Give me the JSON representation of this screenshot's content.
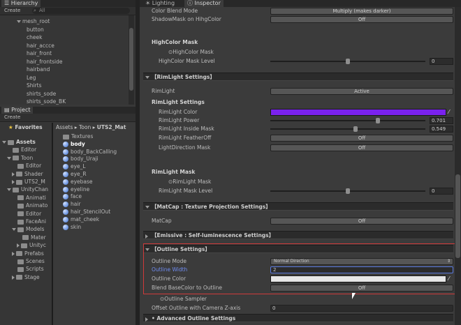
{
  "hierarchy": {
    "tab": "Hierarchy",
    "create": "Create",
    "search": "All",
    "items": [
      {
        "label": "mesh_root",
        "indent": 1,
        "arrow": "down"
      },
      {
        "label": "button",
        "indent": 2
      },
      {
        "label": "cheek",
        "indent": 2
      },
      {
        "label": "hair_accce",
        "indent": 2
      },
      {
        "label": "hair_front",
        "indent": 2
      },
      {
        "label": "hair_frontside",
        "indent": 2
      },
      {
        "label": "hairband",
        "indent": 2
      },
      {
        "label": "Leg",
        "indent": 2
      },
      {
        "label": "Shirts",
        "indent": 2
      },
      {
        "label": "shirts_sode",
        "indent": 2
      },
      {
        "label": "shirts_sode_BK",
        "indent": 2
      }
    ]
  },
  "project": {
    "tab": "Project",
    "create": "Create",
    "favorites": "Favorites",
    "folders": [
      {
        "label": "Assets",
        "indent": 0,
        "arrow": "down",
        "bold": true
      },
      {
        "label": "Editor",
        "indent": 1
      },
      {
        "label": "Toon",
        "indent": 1,
        "arrow": "down"
      },
      {
        "label": "Editor",
        "indent": 2
      },
      {
        "label": "Shader",
        "indent": 2,
        "arrow": "right"
      },
      {
        "label": "UTS2_M",
        "indent": 2,
        "arrow": "right"
      },
      {
        "label": "UnityChan",
        "indent": 1,
        "arrow": "down"
      },
      {
        "label": "Animati",
        "indent": 2
      },
      {
        "label": "Animato",
        "indent": 2
      },
      {
        "label": "Editor",
        "indent": 2
      },
      {
        "label": "FaceAni",
        "indent": 2
      },
      {
        "label": "Models",
        "indent": 2,
        "arrow": "down"
      },
      {
        "label": "Mater",
        "indent": 3
      },
      {
        "label": "Unityc",
        "indent": 3,
        "arrow": "right"
      },
      {
        "label": "Prefabs",
        "indent": 2,
        "arrow": "right"
      },
      {
        "label": "Scenes",
        "indent": 2
      },
      {
        "label": "Scripts",
        "indent": 2
      },
      {
        "label": "Stage",
        "indent": 2,
        "arrow": "right"
      }
    ],
    "breadcrumb": [
      "Assets",
      "Toon",
      "UTS2_Mat"
    ],
    "assets": [
      {
        "label": "Textures",
        "kind": "folder"
      },
      {
        "label": "body",
        "kind": "material",
        "selected": true
      },
      {
        "label": "body_BackCalling",
        "kind": "material"
      },
      {
        "label": "body_Uraji",
        "kind": "material"
      },
      {
        "label": "eye_L",
        "kind": "material"
      },
      {
        "label": "eye_R",
        "kind": "material"
      },
      {
        "label": "eyebase",
        "kind": "material"
      },
      {
        "label": "eyeline",
        "kind": "material"
      },
      {
        "label": "face",
        "kind": "material"
      },
      {
        "label": "hair",
        "kind": "material"
      },
      {
        "label": "hair_StencilOut",
        "kind": "material"
      },
      {
        "label": "mat_cheek",
        "kind": "material"
      },
      {
        "label": "skin",
        "kind": "material"
      }
    ]
  },
  "inspector": {
    "tabs": [
      "Lighting",
      "Inspector"
    ],
    "color_blend_mode": {
      "label": "Color Blend Mode",
      "value": "Multiply (makes darker)"
    },
    "shadowmask": {
      "label": "ShadowMask on HihgColor",
      "value": "Off"
    },
    "highcolor_mask_header": "HighColor Mask",
    "highcolor_mask": "HighColor Mask",
    "highcolor_mask_level": {
      "label": "HighColor Mask Level",
      "value": "0",
      "fraction": 0.5
    },
    "rimlight_section": "【RimLight Settings】",
    "rimlight": {
      "label": "RimLight",
      "value": "Active"
    },
    "rimlight_settings_header": "RimLight Settings",
    "rimlight_color": {
      "label": "RimLight Color",
      "color": "#7a22ee"
    },
    "rimlight_power": {
      "label": "RimLight Power",
      "value": "0.701",
      "fraction": 0.7
    },
    "rimlight_inside_mask": {
      "label": "RimLight Inside Mask",
      "value": "0.549",
      "fraction": 0.55
    },
    "rimlight_featheroff": {
      "label": "RimLight FeatherOff",
      "value": "Off"
    },
    "lightdirection_mask": {
      "label": "LightDirection Mask",
      "value": "Off"
    },
    "rimlight_mask_header": "RimLight Mask",
    "rimlight_mask": "RimLight Mask",
    "rimlight_mask_level": {
      "label": "RimLight Mask Level",
      "value": "0",
      "fraction": 0.5
    },
    "matcap_section": "【MatCap : Texture Projection Settings】",
    "matcap": {
      "label": "MatCap",
      "value": "Off"
    },
    "emissive_section": "【Emissive : Self-luminescence Settings】",
    "outline_section": "【Outline Settings】",
    "outline_mode": {
      "label": "Outline Mode",
      "value": "Normal Direction"
    },
    "outline_width": {
      "label": "Outline Width",
      "value": "2"
    },
    "outline_color": {
      "label": "Outline Color",
      "color": "#e6e6e6"
    },
    "blend_basecolor": {
      "label": "Blend BaseColor to Outline",
      "value": "Off"
    },
    "outline_sampler": "Outline Sampler",
    "offset_outline": {
      "label": "Offset Outline with Camera Z-axis",
      "value": "0"
    },
    "advanced_outline_section": "Advanced Outline Settings",
    "highlight_color": "#d03a3a"
  }
}
